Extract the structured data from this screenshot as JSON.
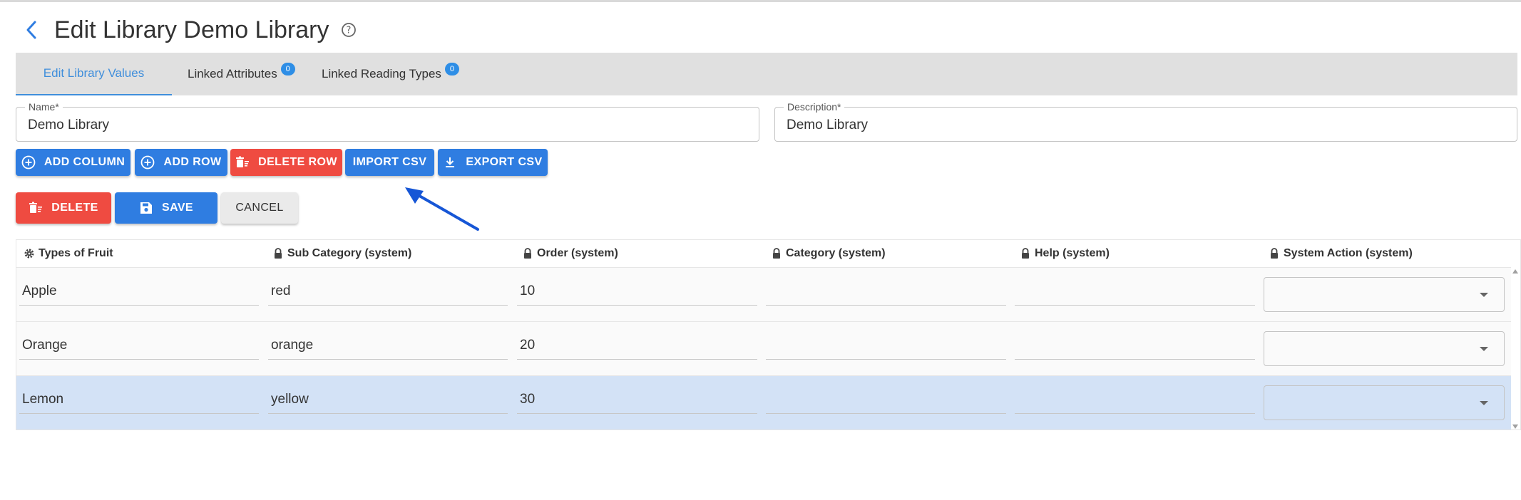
{
  "header": {
    "title": "Edit Library Demo Library",
    "back_icon": "chevron-left-icon",
    "help_icon": "help-circle-icon"
  },
  "tabs": [
    {
      "label": "Edit Library Values",
      "active": true
    },
    {
      "label": "Linked Attributes",
      "badge": "0"
    },
    {
      "label": "Linked Reading Types",
      "badge": "0"
    }
  ],
  "form": {
    "name_label": "Name*",
    "name_value": "Demo Library",
    "description_label": "Description*",
    "description_value": "Demo Library"
  },
  "toolbar": {
    "add_column": "ADD COLUMN",
    "add_row": "ADD ROW",
    "delete_row": "DELETE ROW",
    "import_csv": "IMPORT CSV",
    "export_csv": "EXPORT CSV"
  },
  "actions": {
    "delete": "DELETE",
    "save": "SAVE",
    "cancel": "CANCEL"
  },
  "table": {
    "columns": [
      {
        "label": "Types of Fruit",
        "icon": "gear-icon"
      },
      {
        "label": "Sub Category (system)",
        "icon": "lock-icon"
      },
      {
        "label": "Order (system)",
        "icon": "lock-icon"
      },
      {
        "label": "Category (system)",
        "icon": "lock-icon"
      },
      {
        "label": "Help (system)",
        "icon": "lock-icon"
      },
      {
        "label": "System Action (system)",
        "icon": "lock-icon"
      }
    ],
    "rows": [
      {
        "fruit": "Apple",
        "sub_category": "red",
        "order": "10",
        "category": "",
        "help": "",
        "system_action": "",
        "selected": false
      },
      {
        "fruit": "Orange",
        "sub_category": "orange",
        "order": "20",
        "category": "",
        "help": "",
        "system_action": "",
        "selected": false
      },
      {
        "fruit": "Lemon",
        "sub_category": "yellow",
        "order": "30",
        "category": "",
        "help": "",
        "system_action": "",
        "selected": true
      }
    ]
  },
  "colors": {
    "primary": "#2f7de1",
    "danger": "#ef4b41",
    "tab_active": "#3f8edb",
    "selected_row": "#d3e2f6",
    "annotation_arrow": "#1656d6"
  }
}
